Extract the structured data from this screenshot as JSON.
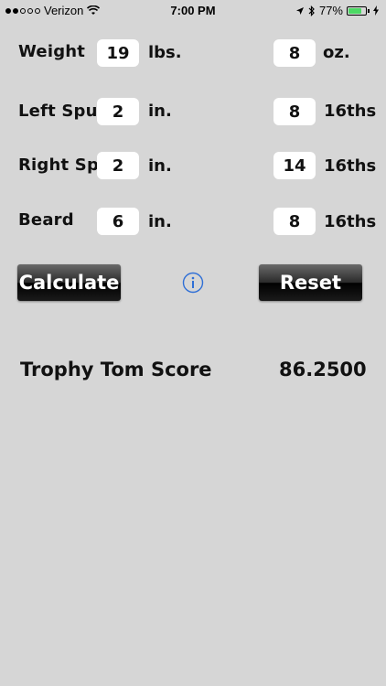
{
  "status": {
    "carrier": "Verizon",
    "time": "7:00 PM",
    "battery": "77%",
    "battery_level": 0.77,
    "signal_bars_filled": 2,
    "signal_bars_total": 5
  },
  "rows": [
    {
      "label": "Weight",
      "value1": "19",
      "unit1": "lbs.",
      "value2": "8",
      "unit2": "oz."
    },
    {
      "label": "Left Spur",
      "value1": "2",
      "unit1": "in.",
      "value2": "8",
      "unit2": "16ths"
    },
    {
      "label": "Right Spur",
      "value1": "2",
      "unit1": "in.",
      "value2": "14",
      "unit2": "16ths"
    },
    {
      "label": "Beard",
      "value1": "6",
      "unit1": "in.",
      "value2": "8",
      "unit2": "16ths"
    }
  ],
  "buttons": {
    "calculate": "Calculate",
    "reset": "Reset"
  },
  "result": {
    "label": "Trophy Tom Score",
    "value": "86.2500"
  }
}
